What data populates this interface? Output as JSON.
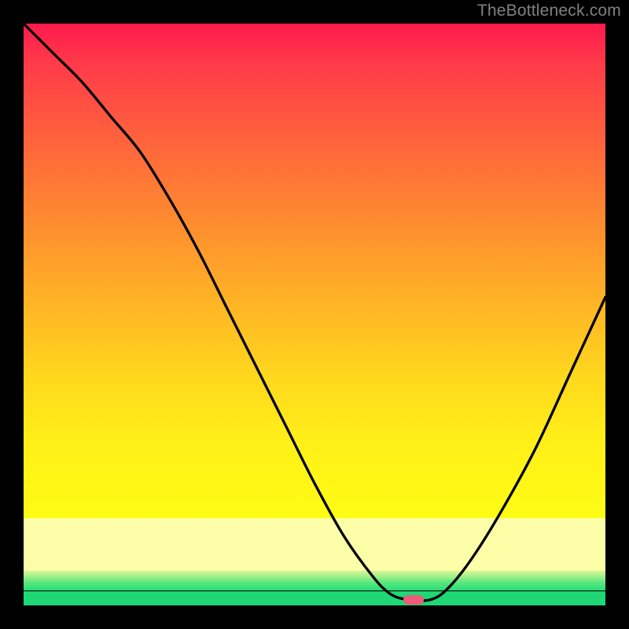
{
  "watermark": "TheBottleneck.com",
  "chart_data": {
    "type": "line",
    "title": "",
    "xlabel": "",
    "ylabel": "",
    "xlim": [
      0,
      100
    ],
    "ylim": [
      0,
      100
    ],
    "grid": false,
    "legend": false,
    "background": {
      "type": "vertical-gradient",
      "stops": [
        {
          "pos": 0,
          "color": "#ff1a4d"
        },
        {
          "pos": 8,
          "color": "#ff3a4a"
        },
        {
          "pos": 20,
          "color": "#ff5a3f"
        },
        {
          "pos": 33,
          "color": "#ff7a35"
        },
        {
          "pos": 46,
          "color": "#ff9a2c"
        },
        {
          "pos": 59,
          "color": "#ffba24"
        },
        {
          "pos": 72,
          "color": "#ffd91d"
        },
        {
          "pos": 85,
          "color": "#fdfea8"
        },
        {
          "pos": 94,
          "color": "#9ef08a"
        },
        {
          "pos": 97,
          "color": "#26de78"
        },
        {
          "pos": 100,
          "color": "#1fd775"
        }
      ]
    },
    "series": [
      {
        "name": "bottleneck-curve",
        "color": "#000000",
        "x": [
          0,
          5,
          10,
          15,
          20,
          25,
          30,
          35,
          40,
          45,
          50,
          55,
          60,
          63,
          66,
          70,
          73,
          77,
          82,
          88,
          94,
          100
        ],
        "y": [
          100,
          95,
          90,
          84,
          78,
          70,
          61,
          51,
          41,
          31,
          21,
          12,
          5,
          2,
          1,
          1,
          3,
          8,
          16,
          27,
          40,
          53
        ]
      }
    ],
    "marker": {
      "name": "optimal-point",
      "x": 67,
      "y": 1,
      "color": "#f15a7a",
      "shape": "pill"
    }
  }
}
